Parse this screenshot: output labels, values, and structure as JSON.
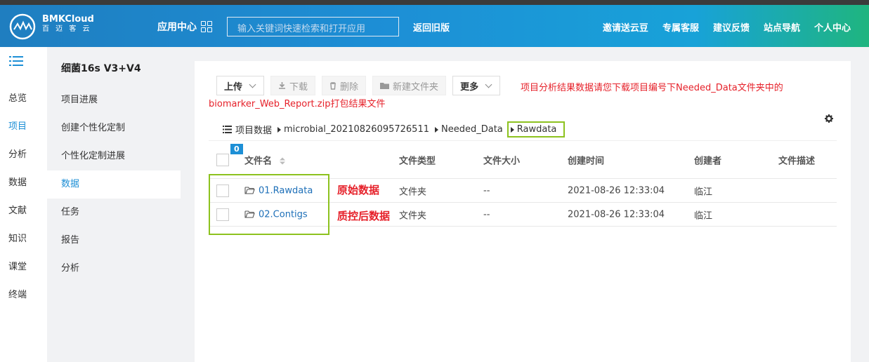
{
  "header": {
    "brand_name": "BMKCloud",
    "brand_sub": "百 迈 客 云",
    "app_center": "应用中心",
    "search_placeholder": "输入关键词快速检索和打开应用",
    "back_old": "返回旧版",
    "nav": [
      "邀请送云豆",
      "专属客服",
      "建议反馈",
      "站点导航",
      "个人中心"
    ]
  },
  "sidebar1": {
    "items": [
      "总览",
      "项目",
      "分析",
      "数据",
      "文献",
      "知识",
      "课堂",
      "终端"
    ],
    "active": "项目"
  },
  "sidebar2": {
    "project_title": "细菌16s V3+V4",
    "items": [
      "项目进展",
      "创建个性化定制",
      "个性化定制进展",
      "数据",
      "任务",
      "报告",
      "分析"
    ],
    "active": "数据"
  },
  "toolbar": {
    "upload": "上传",
    "download": "下载",
    "delete": "删除",
    "new_folder": "新建文件夹",
    "more": "更多"
  },
  "notice": {
    "line1": "项目分析结果数据请您下载项目编号下Needed_Data文件夹中的",
    "line2": "biomarker_Web_Report.zip打包结果文件"
  },
  "breadcrumb": {
    "root": "项目数据",
    "parts": [
      "microbial_20210826095726511",
      "Needed_Data"
    ],
    "current": "Rawdata"
  },
  "table": {
    "selected_count": "0",
    "columns": [
      "文件名",
      "文件类型",
      "文件大小",
      "创建时间",
      "创建者",
      "文件描述"
    ],
    "rows": [
      {
        "name": "01.Rawdata",
        "type": "文件夹",
        "size": "--",
        "created": "2021-08-26 12:33:04",
        "creator": "临江",
        "desc": ""
      },
      {
        "name": "02.Contigs",
        "type": "文件夹",
        "size": "--",
        "created": "2021-08-26 12:33:04",
        "creator": "临江",
        "desc": ""
      }
    ]
  },
  "annotations": [
    "原始数据",
    "质控后数据"
  ],
  "colors": {
    "accent": "#1d8fd6",
    "highlight": "#8dc21f",
    "warning": "#e6212a"
  }
}
